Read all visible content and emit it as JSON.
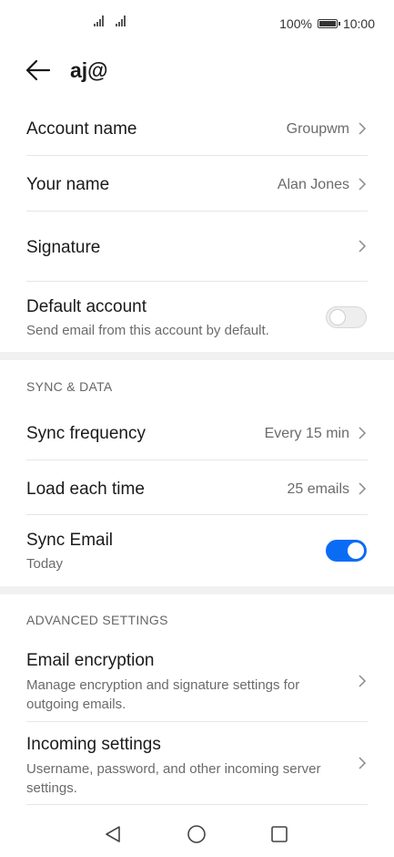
{
  "status_bar": {
    "battery_percent": "100%",
    "time": "10:00",
    "battery_level": 1.0
  },
  "header": {
    "title": "aj@",
    "back_icon": "back-arrow-icon"
  },
  "account": {
    "account_name": {
      "label": "Account name",
      "value": "Groupwm"
    },
    "your_name": {
      "label": "Your name",
      "value": "Alan Jones"
    },
    "signature": {
      "label": "Signature"
    },
    "default_account": {
      "label": "Default account",
      "description": "Send email from this account by default.",
      "enabled": false
    }
  },
  "sync_data": {
    "header": "SYNC & DATA",
    "sync_frequency": {
      "label": "Sync frequency",
      "value": "Every 15 min"
    },
    "load_each_time": {
      "label": "Load each time",
      "value": "25 emails"
    },
    "sync_email": {
      "label": "Sync Email",
      "description": "Today",
      "enabled": true
    }
  },
  "advanced": {
    "header": "ADVANCED SETTINGS",
    "email_encryption": {
      "label": "Email encryption",
      "description": "Manage encryption and signature settings for outgoing emails."
    },
    "incoming_settings": {
      "label": "Incoming settings",
      "description": "Username, password, and other incoming server settings."
    }
  },
  "colors": {
    "accent": "#0a6cf5",
    "divider": "#e6e6e6",
    "section_gap": "#f1f1f1",
    "secondary_text": "#6b6b6b"
  },
  "nav_bar": {
    "back": "triangle-back-icon",
    "home": "circle-home-icon",
    "recents": "square-recents-icon"
  }
}
